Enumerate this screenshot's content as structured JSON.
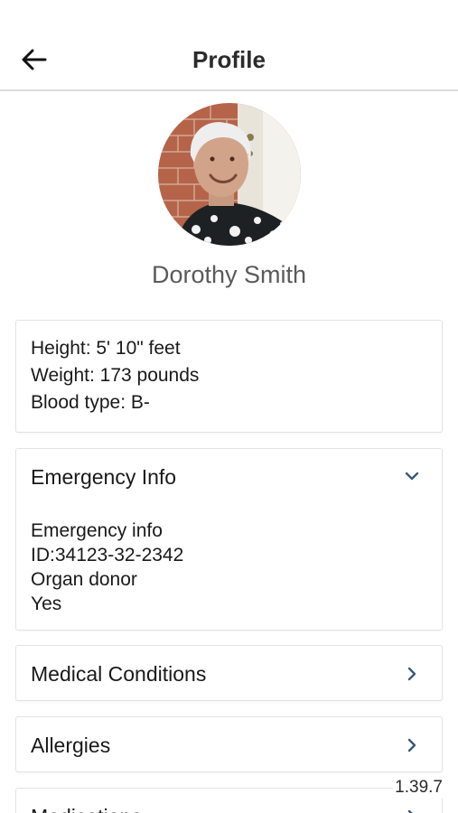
{
  "header": {
    "title": "Profile",
    "back_icon": "arrow-left-icon"
  },
  "profile": {
    "name": "Dorothy Smith",
    "avatar": "user-photo"
  },
  "vitals": {
    "height": "Height: 5' 10\" feet",
    "weight": "Weight: 173 pounds",
    "blood_type": "Blood type: B-"
  },
  "emergency": {
    "title": "Emergency Info",
    "expanded": true,
    "chevron_icon": "chevron-down-icon",
    "lines": [
      "Emergency info",
      "ID:34123-32-2342",
      "Organ donor",
      "Yes"
    ]
  },
  "sections": [
    {
      "title": "Medical Conditions",
      "icon": "chevron-right-icon"
    },
    {
      "title": "Allergies",
      "icon": "chevron-right-icon"
    },
    {
      "title": "Medications",
      "icon": "chevron-right-icon"
    }
  ],
  "version": "1.39.7",
  "colors": {
    "accent": "#3a5a7a",
    "text": "#1a1a1a",
    "name_text": "#5a5a5a",
    "divider": "#dcdcdc"
  }
}
